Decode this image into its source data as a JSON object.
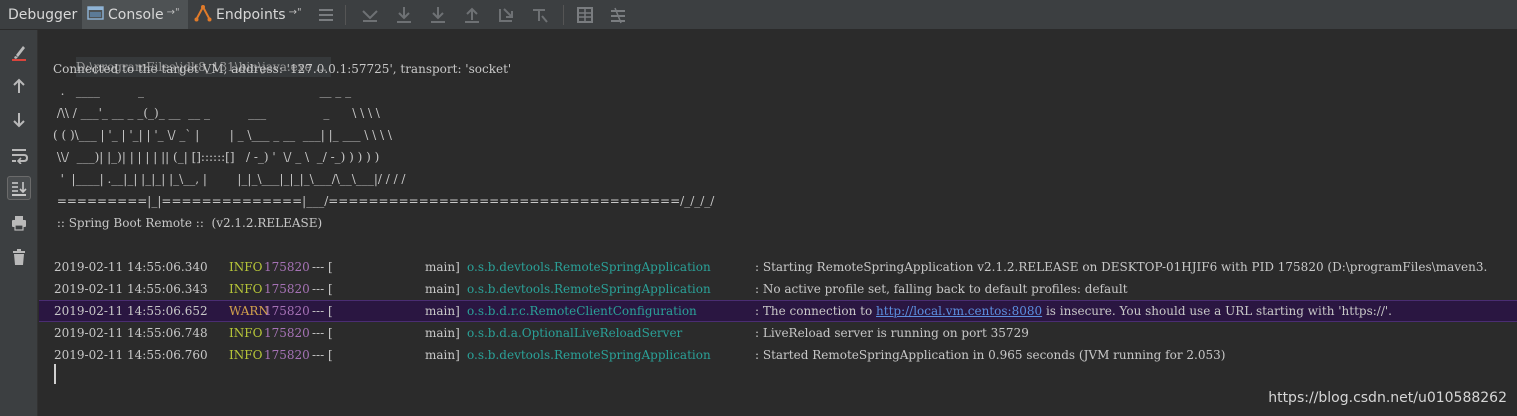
{
  "toolbar": {
    "debugger_label": "Debugger",
    "console_label": "Console",
    "endpoints_label": "Endpoints",
    "pin_glyph": "→\""
  },
  "colors": {
    "toolbar_bg": "#3c3f41",
    "console_bg": "#2b2b2b",
    "info": "#b7c639",
    "warn": "#d2a24d",
    "pid": "#a572b5",
    "logger": "#2aa198",
    "link": "#5c8fe0",
    "warn_row_bg": "#2a1641"
  },
  "console": {
    "command": "D:\\programFiles\\jdk8_131\\bin\\java.exe ...",
    "connected": "Connected to the target VM, address: '127.0.0.1:57725', transport: 'socket'",
    "banner": [
      "  .   ____          _                                              __ _ _",
      " /\\\\ / ___'_ __ _ _(_)_ __  __ _          ___               _      \\ \\ \\ \\",
      "( ( )\\___ | '_ | '_| | '_ \\/ _` |        | _ \\___ _ __  ___| |_ ___ \\ \\ \\ \\",
      " \\\\/  ___)| |_)| | | | | || (_| []::::::[]   / -_) '  \\/ _ \\  _/ -_) ) ) ) )",
      "  '  |____| .__|_| |_|_| |_\\__, |        |_|_\\___|_|_|_\\___/\\__\\___|/ / / /",
      " =========|_|==============|___/===================================/_/_/_/",
      " :: Spring Boot Remote ::  (v2.1.2.RELEASE)"
    ],
    "log": [
      {
        "timestamp": "2019-02-11 14:55:06.340",
        "level": "INFO",
        "pid": "175820",
        "dashes": "--- [",
        "thread": "main]",
        "logger": "o.s.b.devtools.RemoteSpringApplication",
        "message": ": Starting RemoteSpringApplication v2.1.2.RELEASE on DESKTOP-01HJIF6 with PID 175820 (D:\\programFiles\\maven3."
      },
      {
        "timestamp": "2019-02-11 14:55:06.343",
        "level": "INFO",
        "pid": "175820",
        "dashes": "--- [",
        "thread": "main]",
        "logger": "o.s.b.devtools.RemoteSpringApplication",
        "message": ": No active profile set, falling back to default profiles: default"
      },
      {
        "timestamp": "2019-02-11 14:55:06.652",
        "level": "WARN",
        "pid": "175820",
        "dashes": "--- [",
        "thread": "main]",
        "logger": "o.s.b.d.r.c.RemoteClientConfiguration",
        "message_pre": ": The connection to ",
        "message_link": "http://local.vm.centos:8080",
        "message_post": " is insecure. You should use a URL starting with 'https://'."
      },
      {
        "timestamp": "2019-02-11 14:55:06.748",
        "level": "INFO",
        "pid": "175820",
        "dashes": "--- [",
        "thread": "main]",
        "logger": "o.s.b.d.a.OptionalLiveReloadServer",
        "message": ": LiveReload server is running on port 35729"
      },
      {
        "timestamp": "2019-02-11 14:55:06.760",
        "level": "INFO",
        "pid": "175820",
        "dashes": "--- [",
        "thread": "main]",
        "logger": "o.s.b.devtools.RemoteSpringApplication",
        "message": ": Started RemoteSpringApplication in 0.965 seconds (JVM running for 2.053)"
      }
    ]
  },
  "watermark": "https://blog.csdn.net/u010588262"
}
